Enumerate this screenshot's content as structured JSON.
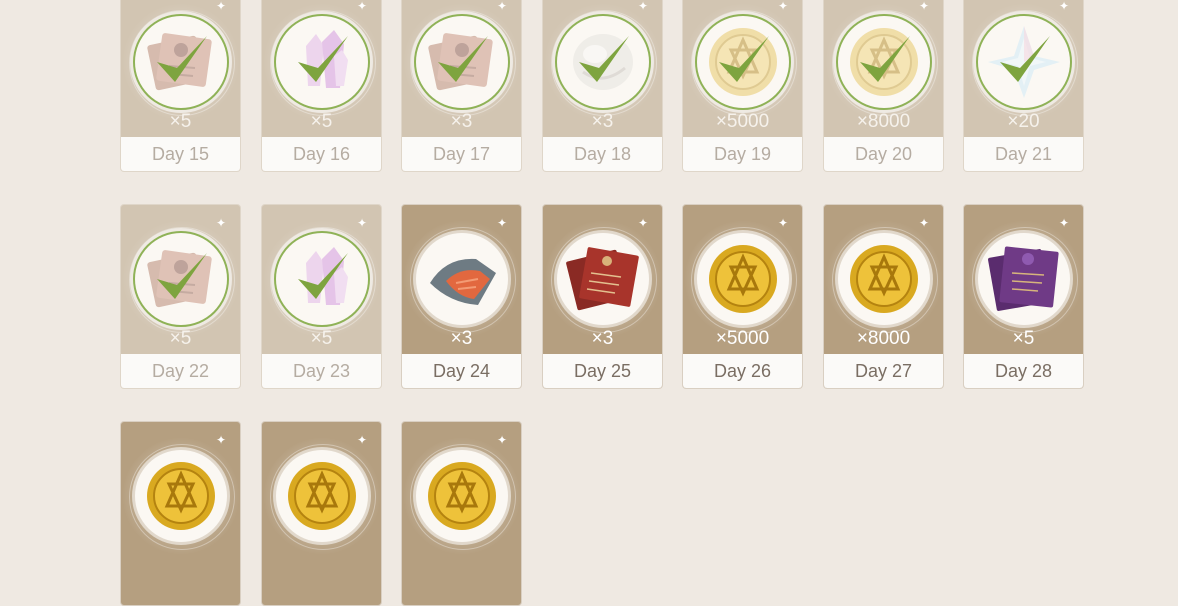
{
  "colors": {
    "page_bg": "#efe9e2",
    "card_unclaimed": "#b59f80",
    "card_claimed": "#d2c5b2",
    "check_green": "#7ea43f"
  },
  "rewards": [
    {
      "day": "Day 15",
      "qty": "×5",
      "icon": "hero-wit-book-icon",
      "claimed": true
    },
    {
      "day": "Day 16",
      "qty": "×5",
      "icon": "purple-crystal-icon",
      "claimed": true
    },
    {
      "day": "Day 17",
      "qty": "×3",
      "icon": "hero-wit-book-icon",
      "claimed": true
    },
    {
      "day": "Day 18",
      "qty": "×3",
      "icon": "white-ore-icon",
      "claimed": true
    },
    {
      "day": "Day 19",
      "qty": "×5000",
      "icon": "mora-coin-icon",
      "claimed": true
    },
    {
      "day": "Day 20",
      "qty": "×8000",
      "icon": "mora-coin-icon",
      "claimed": true
    },
    {
      "day": "Day 21",
      "qty": "×20",
      "icon": "primogem-star-icon",
      "claimed": true
    },
    {
      "day": "Day 22",
      "qty": "×5",
      "icon": "hero-wit-book-icon",
      "claimed": true
    },
    {
      "day": "Day 23",
      "qty": "×5",
      "icon": "purple-crystal-icon",
      "claimed": true
    },
    {
      "day": "Day 24",
      "qty": "×3",
      "icon": "salmon-fish-icon",
      "claimed": false
    },
    {
      "day": "Day 25",
      "qty": "×3",
      "icon": "red-book-icon",
      "claimed": false
    },
    {
      "day": "Day 26",
      "qty": "×5000",
      "icon": "mora-coin-icon",
      "claimed": false
    },
    {
      "day": "Day 27",
      "qty": "×8000",
      "icon": "mora-coin-icon",
      "claimed": false
    },
    {
      "day": "Day 28",
      "qty": "×5",
      "icon": "purple-book-icon",
      "claimed": false
    },
    {
      "day": "",
      "qty": "",
      "icon": "mora-coin-icon",
      "claimed": false
    },
    {
      "day": "",
      "qty": "",
      "icon": "mora-coin-icon",
      "claimed": false
    },
    {
      "day": "",
      "qty": "",
      "icon": "mora-coin-icon",
      "claimed": false
    }
  ]
}
